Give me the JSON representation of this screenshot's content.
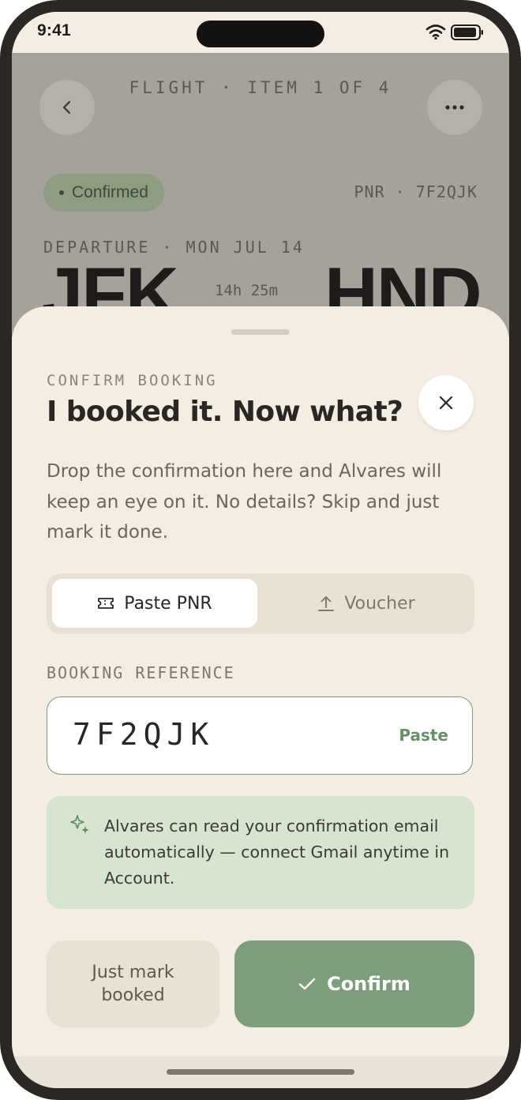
{
  "status_bar": {
    "time": "9:41"
  },
  "background_page": {
    "eyebrow": "FLIGHT · ITEM 1 OF 4",
    "status_badge": "Confirmed",
    "pnr": "PNR · 7F2QJK",
    "departure_label": "DEPARTURE · MON JUL 14",
    "origin": "JFK",
    "destination": "HND",
    "duration": "14h 25m"
  },
  "sheet": {
    "eyebrow": "CONFIRM BOOKING",
    "title": "I booked it. Now what?",
    "description": "Drop the confirmation here and Alvares will keep an eye on it. No details? Skip and just mark it done.",
    "tabs": [
      {
        "label": "Paste PNR",
        "icon": "ticket-icon",
        "active": true
      },
      {
        "label": "Voucher",
        "icon": "upload-icon",
        "active": false
      }
    ],
    "field_label": "BOOKING REFERENCE",
    "booking_reference": "7F2QJK",
    "paste_label": "Paste",
    "info_text": "Alvares can read your confirmation email automatically — connect Gmail anytime in Account.",
    "secondary_button": "Just mark booked",
    "primary_button": "Confirm"
  },
  "colors": {
    "sheet_background": "#f3ede4",
    "accent_green": "#7e9d7c",
    "info_background": "#d7e4cf",
    "segment_background": "#e9e1d4",
    "text_dark": "#2a2623"
  }
}
